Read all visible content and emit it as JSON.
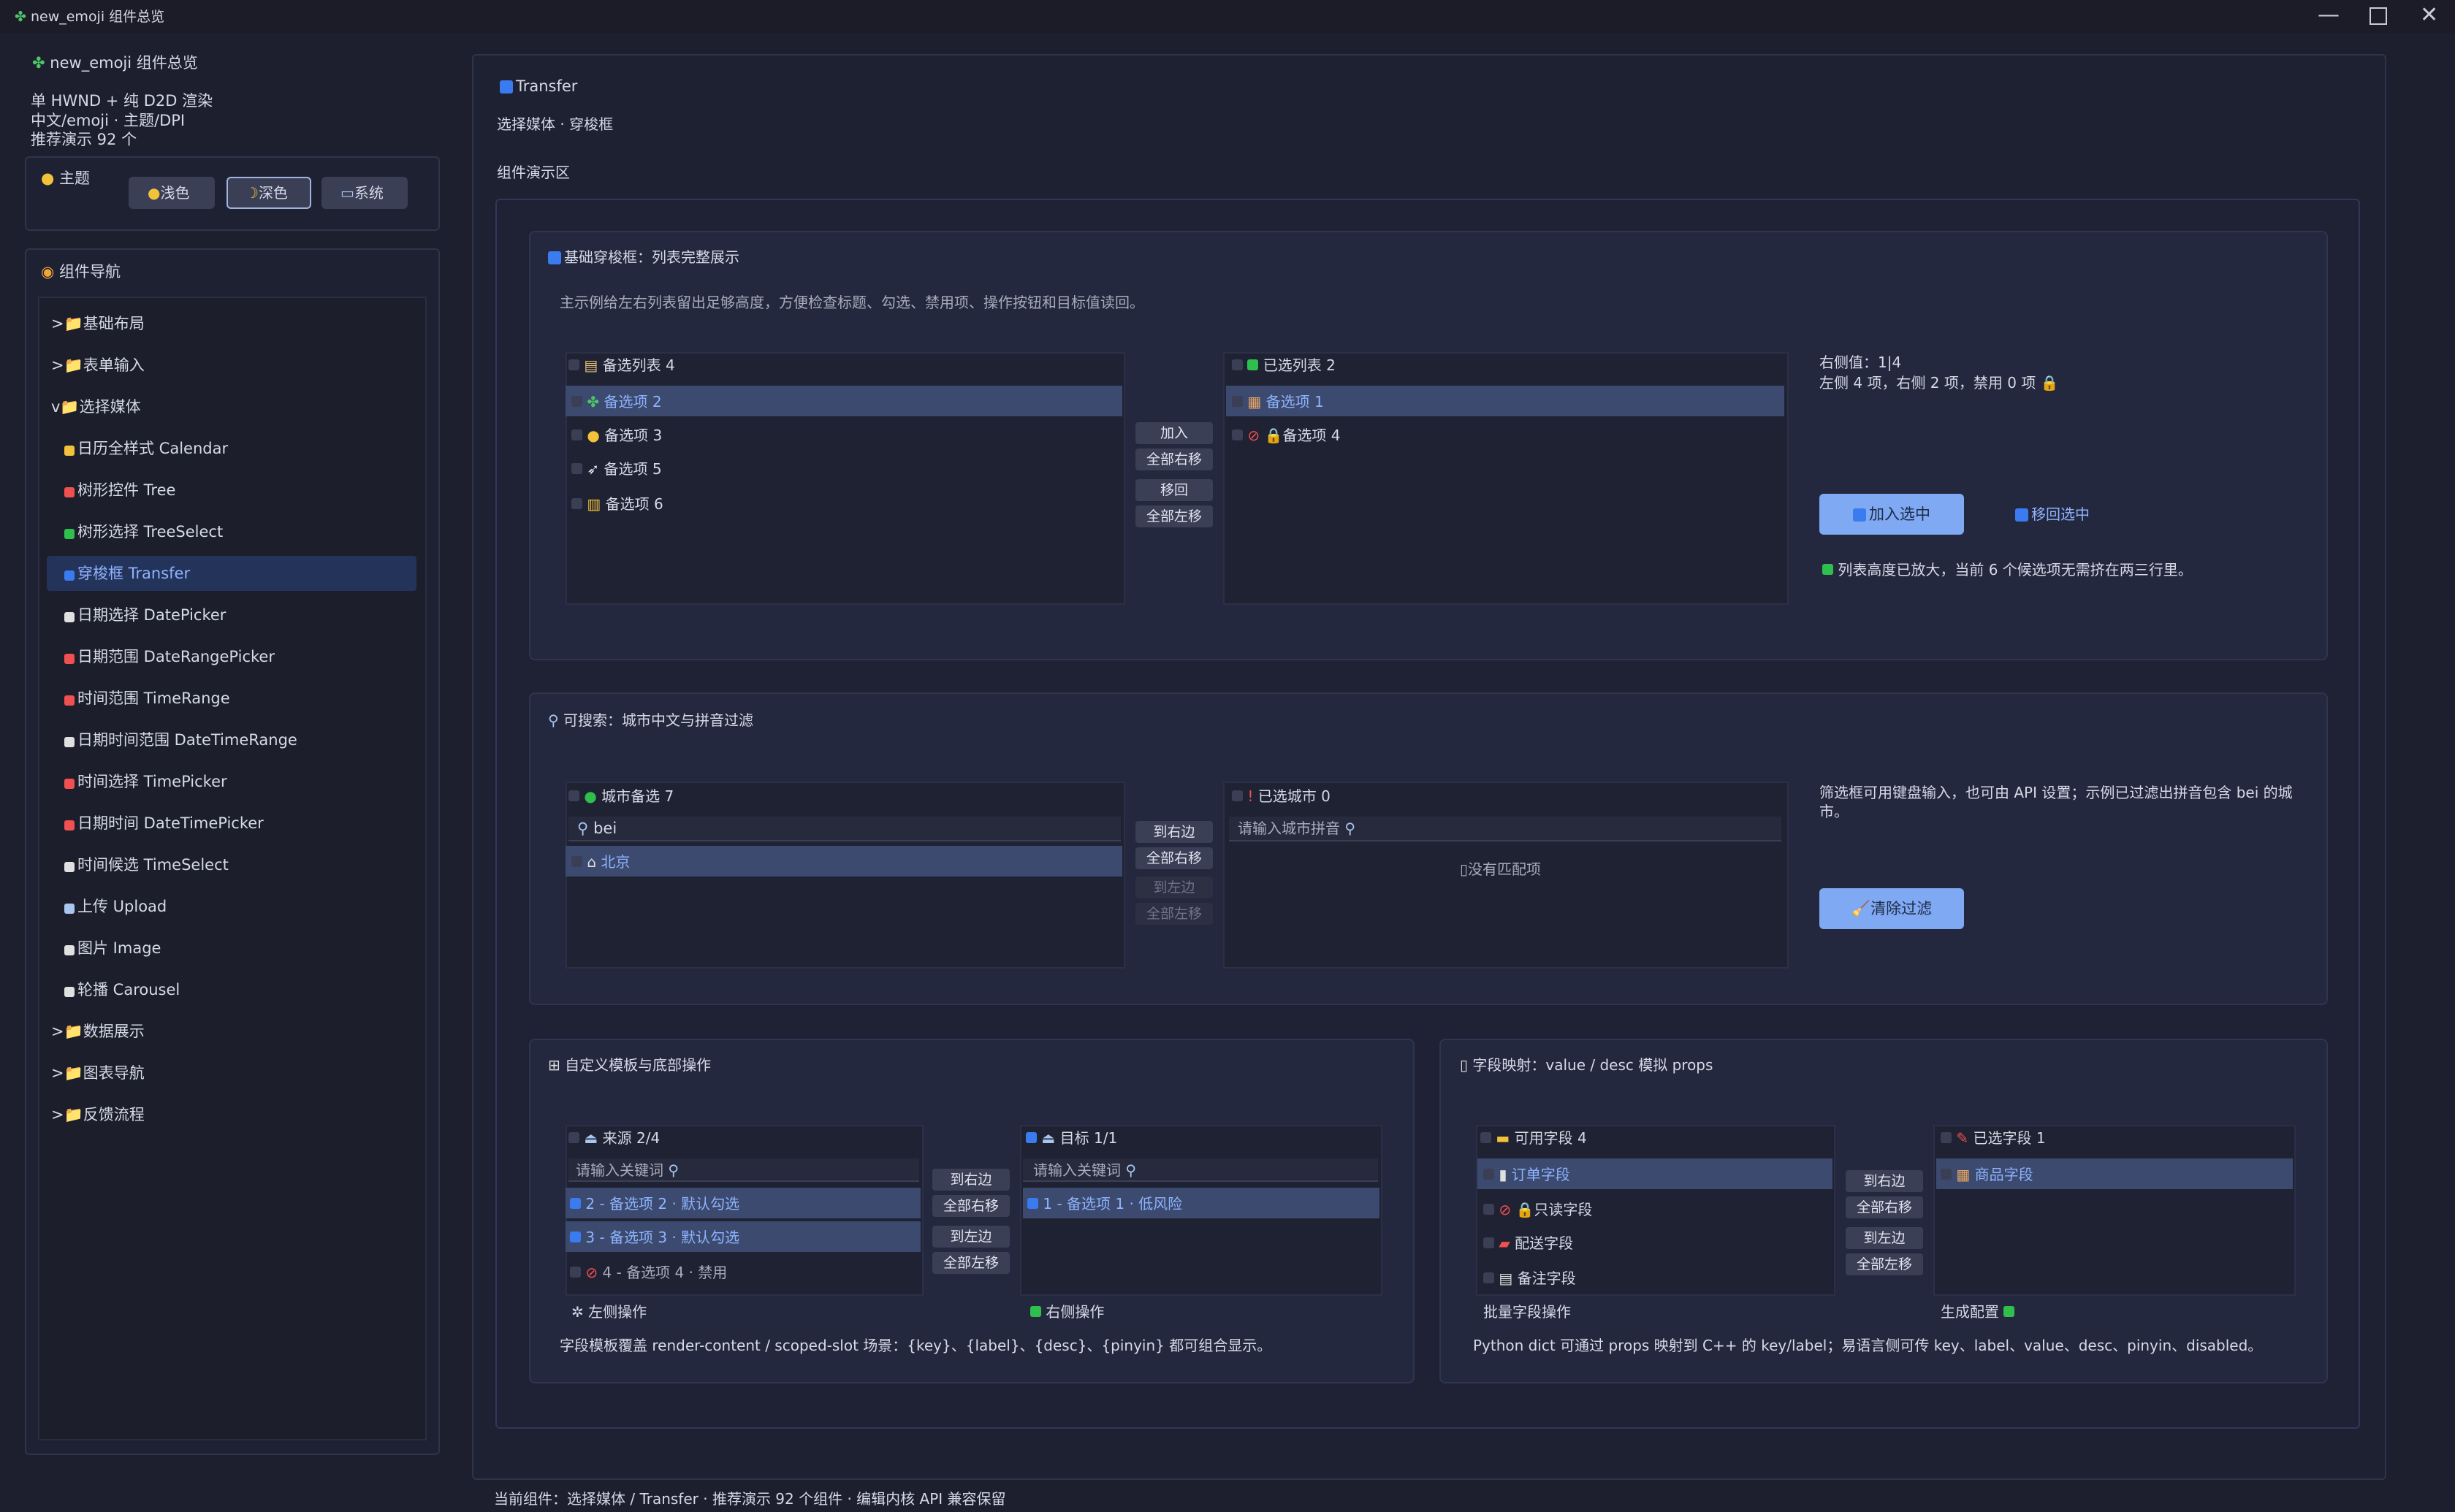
{
  "window": {
    "title": "new_emoji 组件总览"
  },
  "sidebar": {
    "app_title": "new_emoji 组件总览",
    "desc": [
      "单 HWND + 纯 D2D 渲染",
      "中文/emoji · 主题/DPI",
      "推荐演示 92 个"
    ],
    "theme_label": "主题",
    "theme_buttons": [
      "浅色",
      "深色",
      "系统"
    ],
    "nav_title": "组件导航",
    "nav": [
      {
        "label": ">📁基础布局",
        "indent": 0
      },
      {
        "label": ">📁表单输入",
        "indent": 0
      },
      {
        "label": "v📁选择媒体",
        "indent": 0
      },
      {
        "label": "日历全样式 Calendar",
        "indent": 1
      },
      {
        "label": "树形控件 Tree",
        "indent": 1
      },
      {
        "label": "树形选择 TreeSelect",
        "indent": 1
      },
      {
        "label": "穿梭框 Transfer",
        "indent": 1,
        "active": true
      },
      {
        "label": "日期选择 DatePicker",
        "indent": 1
      },
      {
        "label": "日期范围 DateRangePicker",
        "indent": 1
      },
      {
        "label": "时间范围 TimeRange",
        "indent": 1
      },
      {
        "label": "日期时间范围 DateTimeRange",
        "indent": 1
      },
      {
        "label": "时间选择 TimePicker",
        "indent": 1
      },
      {
        "label": "日期时间 DateTimePicker",
        "indent": 1
      },
      {
        "label": "时间候选 TimeSelect",
        "indent": 1
      },
      {
        "label": "上传 Upload",
        "indent": 1
      },
      {
        "label": "图片 Image",
        "indent": 1
      },
      {
        "label": "轮播 Carousel",
        "indent": 1
      },
      {
        "label": ">📁数据展示",
        "indent": 0
      },
      {
        "label": ">📁图表导航",
        "indent": 0
      },
      {
        "label": ">📁反馈流程",
        "indent": 0
      }
    ]
  },
  "main": {
    "title": "Transfer",
    "subtitle": "选择媒体 · 穿梭框",
    "demo_label": "组件演示区",
    "basic": {
      "title": "基础穿梭框：列表完整展示",
      "desc": "主示例给左右列表留出足够高度，方便检查标题、勾选、禁用项、操作按钮和目标值读回。",
      "left_header": "备选列表  4",
      "left_items": [
        "备选项 2",
        "备选项 3",
        "备选项 5",
        "备选项 6"
      ],
      "buttons": [
        "加入",
        "全部右移",
        "移回",
        "全部左移"
      ],
      "right_header": "已选列表  2",
      "right_items": [
        "备选项 1",
        "备选项 4"
      ],
      "info1": "右侧值：1|4",
      "info2": "左侧 4 项，右侧 2 项，禁用 0 项",
      "btn_add": "加入选中",
      "btn_back": "移回选中",
      "note": "列表高度已放大，当前 6 个候选项无需挤在两三行里。"
    },
    "search": {
      "title": "可搜索：城市中文与拼音过滤",
      "left_header": "城市备选  7",
      "left_filter": "bei",
      "left_items": [
        "北京"
      ],
      "buttons": [
        "到右边",
        "全部右移",
        "到左边",
        "全部左移"
      ],
      "right_header": "已选城市  0",
      "right_placeholder": "请输入城市拼音",
      "right_empty": "没有匹配项",
      "info": "筛选框可用键盘输入，也可由 API 设置；示例已过滤出拼音包含 bei 的城市。",
      "btn_clear": "清除过滤"
    },
    "custom": {
      "title": "自定义模板与底部操作",
      "left_header": "来源  2/4",
      "left_placeholder": "请输入关键词",
      "left_items": [
        "2 - 备选项 2 · 默认勾选",
        "3 - 备选项 3 · 默认勾选",
        "4 - 备选项 4 · 禁用"
      ],
      "buttons": [
        "到右边",
        "全部右移",
        "到左边",
        "全部左移"
      ],
      "right_header": "目标  1/1",
      "right_placeholder": "请输入关键词",
      "right_items": [
        "1 - 备选项 1 · 低风险"
      ],
      "left_footer": "左侧操作",
      "right_footer": "右侧操作",
      "desc": "字段模板覆盖 render-content / scoped-slot 场景：{key}、{label}、{desc}、{pinyin} 都可组合显示。"
    },
    "mapping": {
      "title": "字段映射：value / desc 模拟 props",
      "left_header": "可用字段  4",
      "left_items": [
        "订单字段",
        "只读字段",
        "配送字段",
        "备注字段"
      ],
      "buttons": [
        "到右边",
        "全部右移",
        "到左边",
        "全部左移"
      ],
      "right_header": "已选字段  1",
      "right_items": [
        "商品字段"
      ],
      "left_footer": "批量字段操作",
      "right_footer": "生成配置",
      "desc": "Python dict 可通过 props 映射到 C++ 的 key/label；易语言侧可传 key、label、value、desc、pinyin、disabled。"
    }
  },
  "status": "当前组件：选择媒体 / Transfer · 推荐演示 92 个组件 · 编辑内核 API 兼容保留",
  "colors": {
    "accent": "#7fa9f2",
    "selected_row": "#3b4a6e",
    "selected_text": "#8fb3ff",
    "background": "#1d1f2e"
  }
}
